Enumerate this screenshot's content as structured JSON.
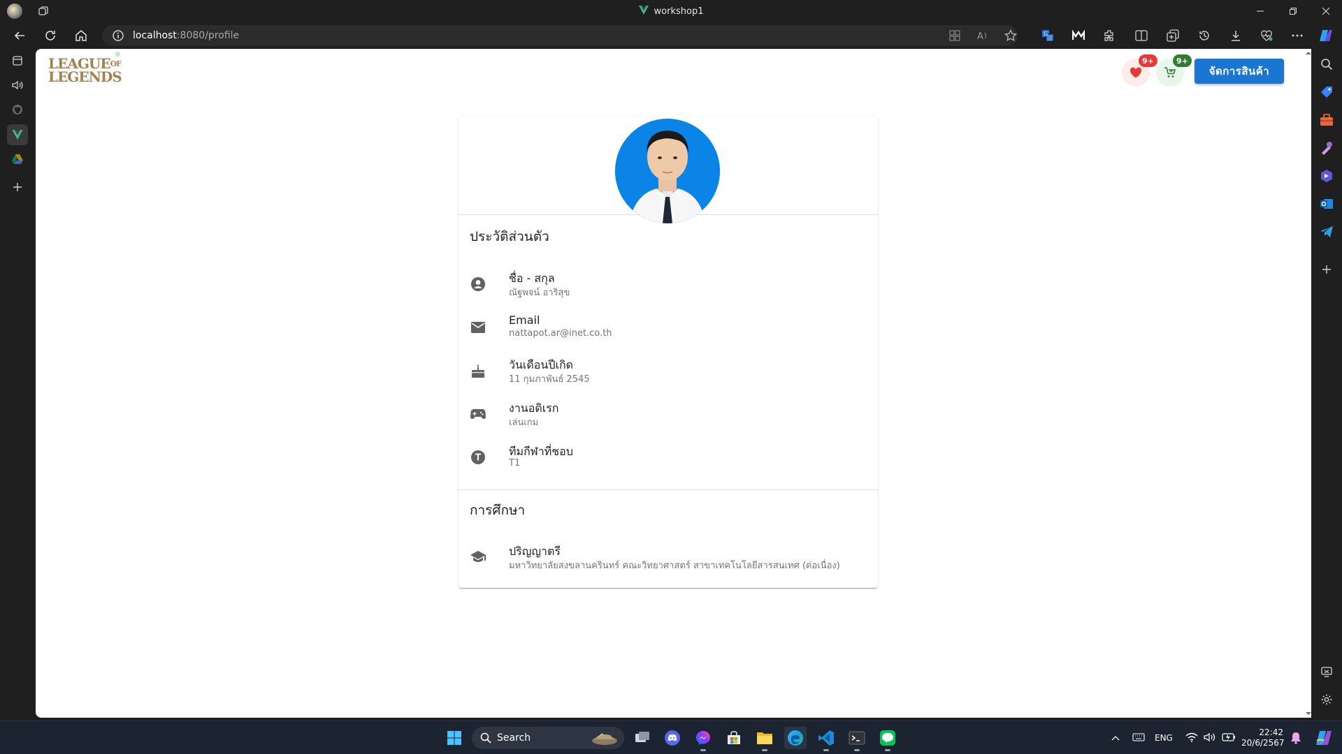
{
  "window": {
    "title": "workshop1"
  },
  "browser": {
    "url_host": "localhost",
    "url_path": ":8080/profile"
  },
  "page": {
    "logo": {
      "line1": "LEAGUE",
      "of": "OF",
      "line2": "LEGENDS"
    },
    "favorites_badge": "9+",
    "cart_badge": "9+",
    "manage_button": "จัดการสินค้า",
    "profile": {
      "section_personal": "ประวัติส่วนตัว",
      "items": [
        {
          "icon": "account-circle-icon",
          "label": "ชื่อ - สกุล",
          "value": "ณัฐพจน์ อาริสุข"
        },
        {
          "icon": "email-icon",
          "label": "Email",
          "value": "nattapot.ar@inet.co.th"
        },
        {
          "icon": "cake-icon",
          "label": "วันเดือนปีเกิด",
          "value": "11 กุมภาพันธ์ 2545"
        },
        {
          "icon": "gamepad-icon",
          "label": "งานอดิเรก",
          "value": "เล่นเกม"
        },
        {
          "icon": "team-t-icon",
          "label": "ทีมกีฬาที่ชอบ",
          "value": "T1"
        }
      ],
      "section_education": "การศึกษา",
      "education": {
        "icon": "graduation-cap-icon",
        "label": "ปริญญาตรี",
        "value": "มหาวิทยาลัยสงขลานครินทร์ คณะวิทยาศาสตร์ สาขาเทคโนโลยีสารสนเทศ (ต่อเนื่อง)"
      }
    }
  },
  "taskbar": {
    "search_label": "Search",
    "language": "ENG",
    "time": "22:42",
    "date": "20/6/2567"
  },
  "colors": {
    "primary_button": "#1976d2",
    "favorite_badge": "#e53935",
    "cart_badge": "#2e7d32",
    "logo_gold": "#a3824e",
    "avatar_bg": "#0b84e8"
  }
}
